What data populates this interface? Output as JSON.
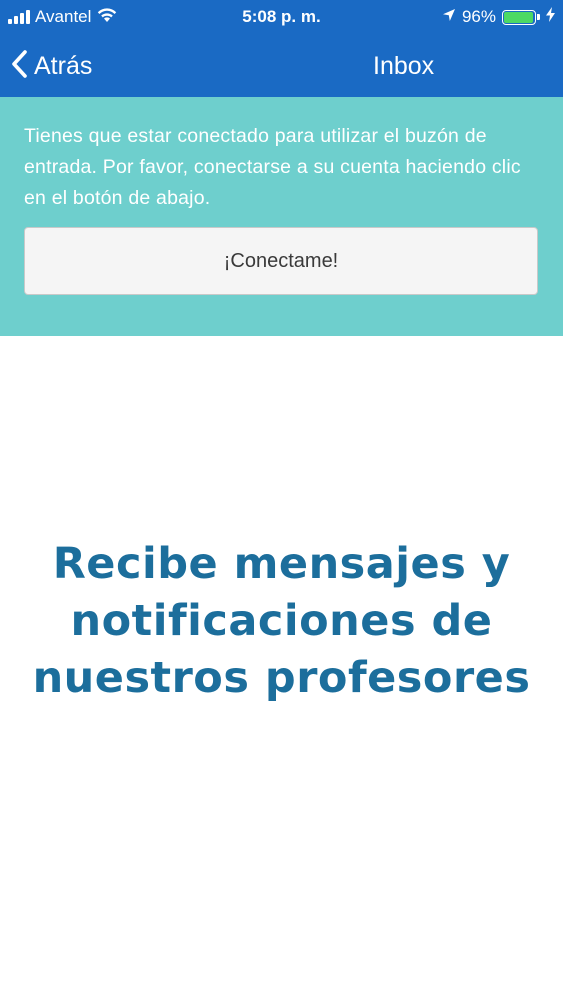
{
  "status_bar": {
    "carrier": "Avantel",
    "time": "5:08 p. m.",
    "battery_percent": "96%",
    "battery_level": 0.96,
    "icons": [
      "signal-bars-icon",
      "wifi-icon",
      "location-arrow-icon",
      "battery-icon",
      "charging-bolt-icon"
    ]
  },
  "nav": {
    "back_label": "Atrás",
    "title": "Inbox",
    "back_icon": "chevron-left-icon"
  },
  "notice": {
    "message": "Tienes que estar conectado para utilizar el buzón de entrada. Por favor, conectarse a su cuenta haciendo clic en el botón de abajo.",
    "button_label": "¡Conectame!"
  },
  "promo": {
    "lines": [
      "Recibe mensajes y",
      "notificaciones de",
      "nuestros profesores"
    ]
  },
  "colors": {
    "nav_background": "#1a6ac4",
    "notice_background": "#6ecfcd",
    "promo_text": "#1c6e9c",
    "battery_fill": "#4cd964"
  }
}
